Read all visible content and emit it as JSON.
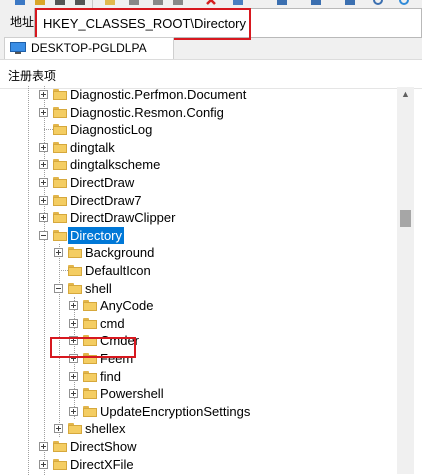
{
  "address": {
    "label": "地址",
    "path": "HKEY_CLASSES_ROOT\\Directory"
  },
  "computer": {
    "name": "DESKTOP-PGLDLPA"
  },
  "tree": {
    "header": "注册表项",
    "nodes": [
      {
        "label": "Diagnostic.Perfmon.Document",
        "expander": "plus"
      },
      {
        "label": "Diagnostic.Resmon.Config",
        "expander": "plus"
      },
      {
        "label": "DiagnosticLog",
        "expander": "none"
      },
      {
        "label": "dingtalk",
        "expander": "plus"
      },
      {
        "label": "dingtalkscheme",
        "expander": "plus"
      },
      {
        "label": "DirectDraw",
        "expander": "plus"
      },
      {
        "label": "DirectDraw7",
        "expander": "plus"
      },
      {
        "label": "DirectDrawClipper",
        "expander": "plus"
      },
      {
        "label": "Directory",
        "expander": "minus",
        "selected": true
      },
      {
        "label": "Background",
        "expander": "plus"
      },
      {
        "label": "DefaultIcon",
        "expander": "none"
      },
      {
        "label": "shell",
        "expander": "minus"
      },
      {
        "label": "AnyCode",
        "expander": "plus"
      },
      {
        "label": "cmd",
        "expander": "plus"
      },
      {
        "label": "Cmder",
        "expander": "plus"
      },
      {
        "label": "Feem",
        "expander": "plus"
      },
      {
        "label": "find",
        "expander": "plus"
      },
      {
        "label": "Powershell",
        "expander": "plus"
      },
      {
        "label": "UpdateEncryptionSettings",
        "expander": "plus"
      },
      {
        "label": "shellex",
        "expander": "plus"
      },
      {
        "label": "DirectShow",
        "expander": "plus"
      },
      {
        "label": "DirectXFile",
        "expander": "plus"
      }
    ]
  },
  "colors": {
    "selection": "#0078d7",
    "highlight_box": "#d7181f",
    "folder": "#f4cd62"
  },
  "icons": [
    "toolbar-icons",
    "computer-icon",
    "folder-icon",
    "chevron-up-icon"
  ]
}
